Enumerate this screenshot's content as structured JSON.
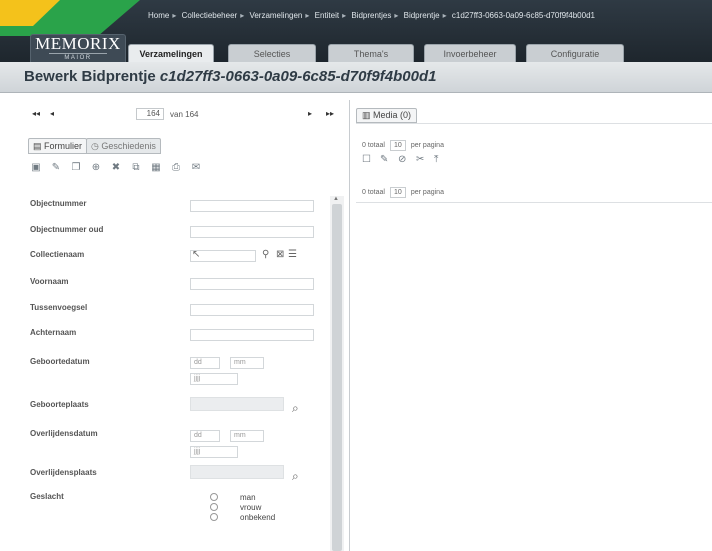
{
  "breadcrumb": [
    "Home",
    "Collectiebeheer",
    "Verzamelingen",
    "Entiteit",
    "Bidprentjes",
    "Bidprentje",
    "c1d27ff3-0663-0a09-6c85-d70f9f4b00d1"
  ],
  "breadcrumb_sep": "▸",
  "brand": {
    "name": "MEMORIX",
    "sub": "MAIOR"
  },
  "nav_tabs": [
    "Verzamelingen",
    "Selecties",
    "Thema's",
    "Invoerbeheer",
    "Configuratie"
  ],
  "title": {
    "prefix": "Bewerk Bidprentje",
    "id": "c1d27ff3-0663-0a09-6c85-d70f9f4b00d1"
  },
  "pager": {
    "first": "◂◂",
    "prev": "◂",
    "next": "▸",
    "last": "▸▸",
    "current": "164",
    "of_label": "van 164"
  },
  "subtabs": {
    "form": "Formulier",
    "history": "Geschiedenis",
    "form_icon": "form-icon",
    "history_icon": "clock-icon"
  },
  "toolbar_icons": [
    "save-icon",
    "edit-icon",
    "copy-icon",
    "new-record-icon",
    "delete-icon",
    "duplicate-icon",
    "export-icon",
    "print-icon",
    "mail-icon"
  ],
  "form": {
    "fields": [
      "Objectnummer",
      "Objectnummer oud",
      "Collectienaam",
      "Voornaam",
      "Tussenvoegsel",
      "Achternaam",
      "Geboortedatum",
      "Geboorteplaats",
      "Overlijdensdatum",
      "Overlijdensplaats",
      "Geslacht"
    ],
    "date_day_placeholder": "dd",
    "date_month_placeholder": "mm",
    "date_year_placeholder": "jjjj",
    "gender_options": [
      "man",
      "vrouw",
      "onbekend"
    ]
  },
  "media": {
    "tab_label": "Media (0)",
    "total_label": "0 totaal",
    "per_page_value": "10",
    "per_page_label": "per pagina"
  },
  "colors": {
    "header": "#2f3a44",
    "accent_green": "#2aa34a",
    "accent_yellow": "#f4c21b",
    "title_text": "#2f3b45"
  }
}
